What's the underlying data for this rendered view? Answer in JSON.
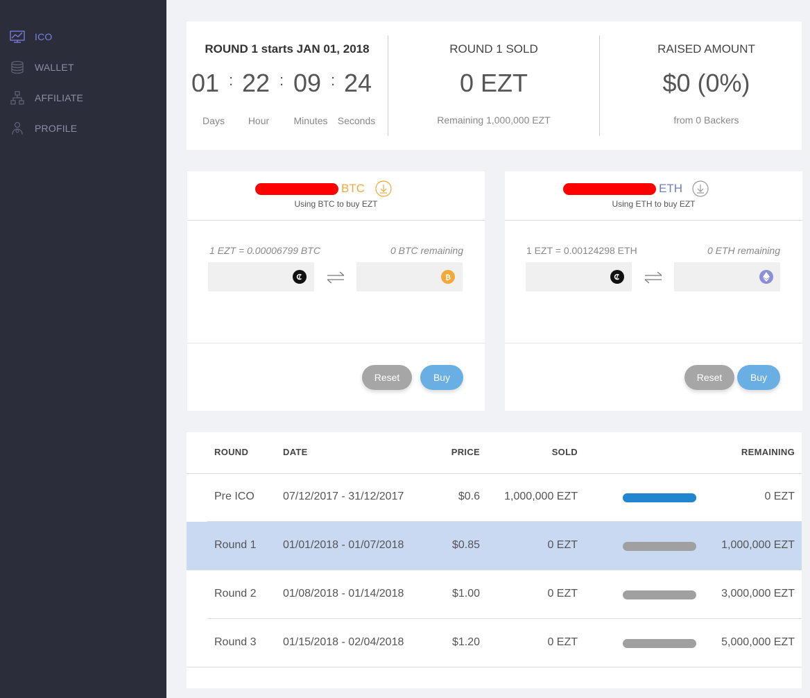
{
  "sidebar": {
    "items": [
      {
        "label": "ICO",
        "icon": "chart-icon"
      },
      {
        "label": "WALLET",
        "icon": "coins-icon"
      },
      {
        "label": "AFFILIATE",
        "icon": "network-icon"
      },
      {
        "label": "PROFILE",
        "icon": "person-icon"
      }
    ]
  },
  "round_start": {
    "title": "ROUND 1 starts JAN 01, 2018",
    "days": "01",
    "hours": "22",
    "minutes": "09",
    "seconds": "24",
    "sep": ":",
    "labels": {
      "days": "Days",
      "hours": "Hour",
      "minutes": "Minutes",
      "seconds": "Seconds"
    }
  },
  "round_sold": {
    "title": "ROUND 1 SOLD",
    "value": "0 EZT",
    "sub": "Remaining 1,000,000 EZT"
  },
  "raised": {
    "title": "RAISED AMOUNT",
    "value": "$0 (0%)",
    "sub": "from 0 Backers"
  },
  "btc": {
    "currency": "BTC",
    "subtitle": "Using BTC to buy EZT",
    "rate": "1 EZT = 0.00006799 BTC",
    "remaining": "0 BTC remaining",
    "input_ezt": "",
    "input_coin": "",
    "reset_label": "Reset",
    "buy_label": "Buy",
    "color": "#f3a83a"
  },
  "eth": {
    "currency": "ETH",
    "subtitle": "Using ETH to buy EZT",
    "rate": "1 EZT = 0.00124298 ETH",
    "remaining": "0 ETH remaining",
    "input_ezt": "",
    "input_coin": "",
    "reset_label": "Reset",
    "buy_label": "Buy",
    "color": "#6c7fbf"
  },
  "table": {
    "headers": {
      "round": "ROUND",
      "date": "DATE",
      "price": "PRICE",
      "sold": "SOLD",
      "remaining": "REMAINING"
    },
    "rows": [
      {
        "round": "Pre ICO",
        "date": "07/12/2017 - 31/12/2017",
        "price": "$0.6",
        "sold": "1,000,000 EZT",
        "remaining": "0 EZT",
        "progress": 1.0
      },
      {
        "round": "Round 1",
        "date": "01/01/2018 - 01/07/2018",
        "price": "$0.85",
        "sold": "0 EZT",
        "remaining": "1,000,000 EZT",
        "progress": 0
      },
      {
        "round": "Round 2",
        "date": "01/08/2018 - 01/14/2018",
        "price": "$1.00",
        "sold": "0 EZT",
        "remaining": "3,000,000 EZT",
        "progress": 0
      },
      {
        "round": "Round 3",
        "date": "01/15/2018 - 02/04/2018",
        "price": "$1.20",
        "sold": "0 EZT",
        "remaining": "5,000,000 EZT",
        "progress": 0
      }
    ]
  },
  "colors": {
    "accent": "#7c7fe0",
    "sidebar_bg": "#2b2d3b",
    "progress_fill": "#2185d0",
    "progress_empty": "#a0a0a0",
    "highlight_row": "#c9d9f2"
  }
}
